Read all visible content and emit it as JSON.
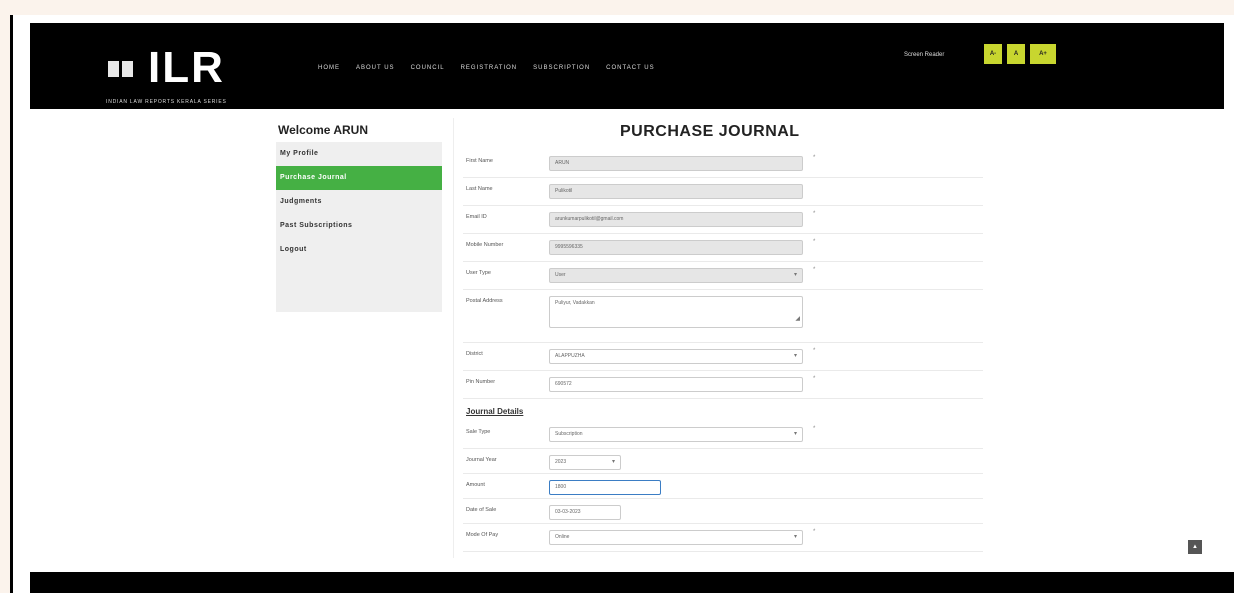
{
  "header": {
    "logo_text": "ILR",
    "logo_subtitle": "INDIAN LAW REPORTS KERALA SERIES",
    "nav": [
      "HOME",
      "ABOUT US",
      "COUNCIL",
      "REGISTRATION",
      "SUBSCRIPTION",
      "CONTACT US"
    ],
    "screen_reader_label": "Screen Reader",
    "font_buttons": [
      "A-",
      "A",
      "A+"
    ],
    "accent_color": "#c8d62f"
  },
  "sidebar": {
    "welcome": "Welcome ARUN",
    "items": [
      "My Profile",
      "Purchase Journal",
      "Judgments",
      "Past Subscriptions",
      "Logout"
    ],
    "active_index": 1,
    "active_color": "#45b044"
  },
  "page_title": "PURCHASE JOURNAL",
  "form": {
    "first_name": {
      "label": "First Name",
      "value": "ARUN"
    },
    "last_name": {
      "label": "Last Name",
      "value": "Pulikotil"
    },
    "email": {
      "label": "Email ID",
      "value": "arunkumarpulikotil@gmail.com"
    },
    "mobile": {
      "label": "Mobile Number",
      "value": "9995596335"
    },
    "user_type": {
      "label": "User Type",
      "value": "User"
    },
    "postal_address": {
      "label": "Postal Address",
      "value": "Puliyur, Vadakkan"
    },
    "district": {
      "label": "District",
      "value": "ALAPPUZHA"
    },
    "pin": {
      "label": "Pin Number",
      "value": "690572"
    },
    "journal_details_heading": "Journal Details",
    "sale_type": {
      "label": "Sale Type",
      "value": "Subscription"
    },
    "journal_year": {
      "label": "Journal Year",
      "value": "2023"
    },
    "amount": {
      "label": "Amount",
      "value": "1800"
    },
    "date_of_sale": {
      "label": "Date of Sale",
      "value": "03-03-2023"
    },
    "mode_of_pay": {
      "label": "Mode Of Pay",
      "value": "Online"
    },
    "required_mark": "*"
  }
}
